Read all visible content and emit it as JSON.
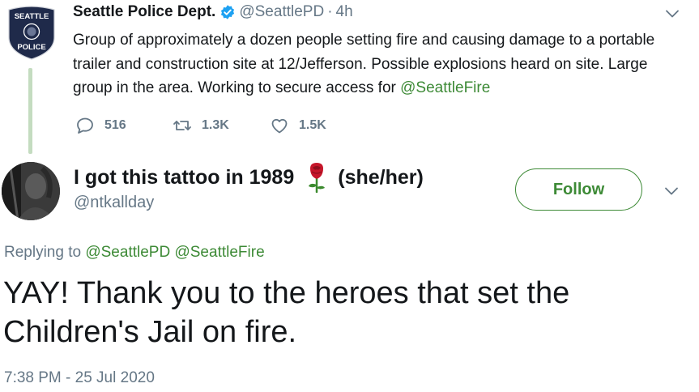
{
  "parent_tweet": {
    "avatar_text_top": "SEATTLE",
    "avatar_text_bottom": "POLICE",
    "name": "Seattle Police Dept.",
    "handle": "@SeattlePD",
    "dot": "·",
    "time": "4h",
    "text_main": "Group of approximately a dozen people setting fire and causing damage to a portable trailer and construction site at 12/Jefferson. Possible explosions heard on site. Large group in the area. Working to secure access for ",
    "text_mention": "@SeattleFire",
    "replies": "516",
    "retweets": "1.3K",
    "likes": "1.5K"
  },
  "reply_tweet": {
    "name_part1": "I got this tattoo in 1989",
    "name_part2": "(she/her)",
    "handle": "@ntkallday",
    "follow_label": "Follow",
    "replying_prefix": "Replying to ",
    "replying_mention1": "@SeattlePD",
    "replying_mention2": "@SeattleFire",
    "text": "YAY! Thank you to the heroes that set the Children's Jail on fire.",
    "timestamp": "7:38 PM - 25 Jul 2020"
  },
  "icons": [
    "chevron-down-icon",
    "verified-badge-icon",
    "reply-icon",
    "retweet-icon",
    "like-icon",
    "rose-emoji-icon"
  ],
  "colors": {
    "accent": "#3d8a36",
    "secondary_text": "#657786",
    "primary_text": "#14171a",
    "thread_line": "#c4dcc0"
  }
}
